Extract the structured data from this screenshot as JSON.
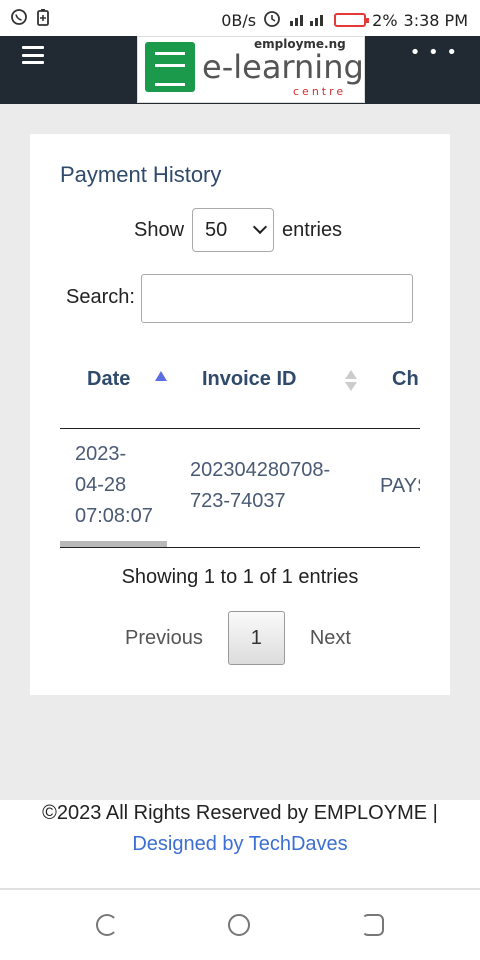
{
  "status_bar": {
    "net_speed": "0B/s",
    "signal": "3G",
    "battery_percent": "2%",
    "time": "3:38 PM"
  },
  "header": {
    "menu_icon": "hamburger-icon",
    "more_icon": "more-dots-icon",
    "logo": {
      "top_text": "employme.ng",
      "main_text": "e-learning",
      "sub_text": "centre"
    }
  },
  "payment": {
    "title": "Payment History",
    "show_label": "Show",
    "entries_value": "50",
    "entries_label": "entries",
    "search_label": "Search:",
    "search_value": "",
    "columns": [
      "Date",
      "Invoice ID",
      "Ch"
    ],
    "rows": [
      {
        "date_line1": "2023-",
        "date_line2": "04-28",
        "date_line3": "07:08:07",
        "invoice_line1": "202304280708-",
        "invoice_line2": "723-74037",
        "channel": "PAYS"
      }
    ],
    "info": "Showing 1 to 1 of 1 entries",
    "pagination": {
      "previous": "Previous",
      "current": "1",
      "next": "Next"
    }
  },
  "footer": {
    "copyright": "©2023 All Rights Reserved by EMPLOYME |",
    "designed_by": "Designed by TechDaves"
  },
  "colors": {
    "topbar": "#212a32",
    "title": "#2f4a6b",
    "link": "#3b6fd4",
    "sort_active": "#5b6ee1"
  }
}
